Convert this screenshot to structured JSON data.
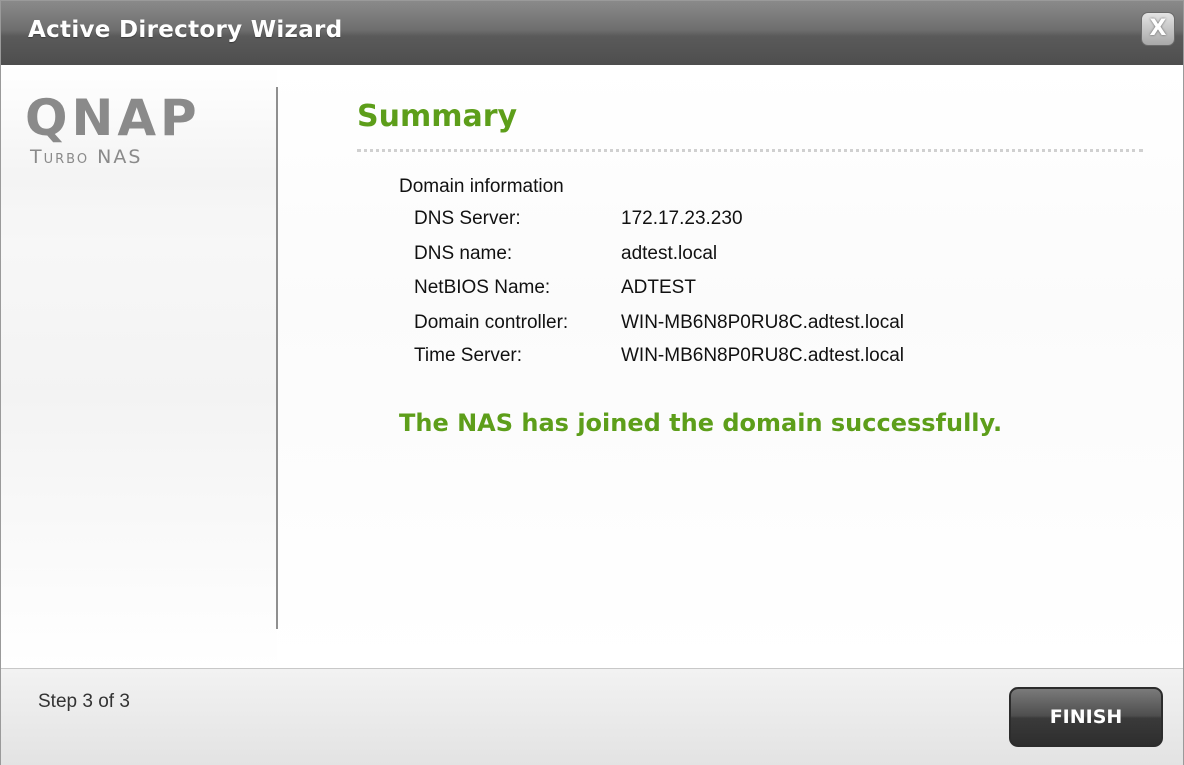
{
  "window": {
    "title": "Active Directory Wizard",
    "close_label": "X"
  },
  "branding": {
    "logo": "QNAP",
    "product": "Turbo NAS"
  },
  "content": {
    "heading": "Summary",
    "section_label": "Domain information",
    "rows": [
      {
        "label": "DNS Server:",
        "value": "172.17.23.230"
      },
      {
        "label": "DNS name:",
        "value": "adtest.local"
      },
      {
        "label": "NetBIOS Name:",
        "value": "ADTEST"
      },
      {
        "label": "Domain controller:",
        "value": "WIN-MB6N8P0RU8C.adtest.local"
      },
      {
        "label": "Time Server:",
        "value": "WIN-MB6N8P0RU8C.adtest.local"
      }
    ],
    "success_message": "The NAS has joined the domain successfully."
  },
  "footer": {
    "step_text": "Step 3 of 3",
    "finish_label": "FINISH"
  },
  "colors": {
    "accent_green": "#5d9e1a",
    "titlebar": "#6e6e6e"
  },
  "icons": {
    "close": "close-icon"
  }
}
